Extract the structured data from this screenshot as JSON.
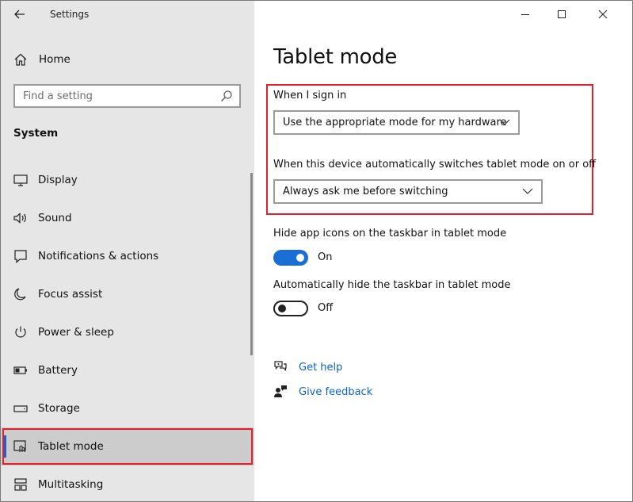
{
  "window": {
    "app_title": "Settings",
    "accent_color": "#1a6fd6",
    "highlight_color": "#e3202a"
  },
  "sidebar": {
    "home_label": "Home",
    "search_placeholder": "Find a setting",
    "section_title": "System",
    "items": [
      {
        "label": "Display",
        "icon": "monitor-icon",
        "selected": false
      },
      {
        "label": "Sound",
        "icon": "speaker-icon",
        "selected": false
      },
      {
        "label": "Notifications & actions",
        "icon": "notifications-icon",
        "selected": false
      },
      {
        "label": "Focus assist",
        "icon": "moon-icon",
        "selected": false
      },
      {
        "label": "Power & sleep",
        "icon": "power-icon",
        "selected": false
      },
      {
        "label": "Battery",
        "icon": "battery-icon",
        "selected": false
      },
      {
        "label": "Storage",
        "icon": "storage-icon",
        "selected": false
      },
      {
        "label": "Tablet mode",
        "icon": "tablet-mode-icon",
        "selected": true
      },
      {
        "label": "Multitasking",
        "icon": "multitasking-icon",
        "selected": false
      }
    ]
  },
  "main": {
    "title": "Tablet mode",
    "sign_in_label": "When I sign in",
    "sign_in_value": "Use the appropriate mode for my hardware",
    "switch_label": "When this device automatically switches tablet mode on or off",
    "switch_value": "Always ask me before switching",
    "hide_icons_label": "Hide app icons on the taskbar in tablet mode",
    "hide_icons_state": "On",
    "hide_icons_on": true,
    "hide_taskbar_label": "Automatically hide the taskbar in tablet mode",
    "hide_taskbar_state": "Off",
    "hide_taskbar_on": false,
    "get_help": "Get help",
    "give_feedback": "Give feedback"
  }
}
